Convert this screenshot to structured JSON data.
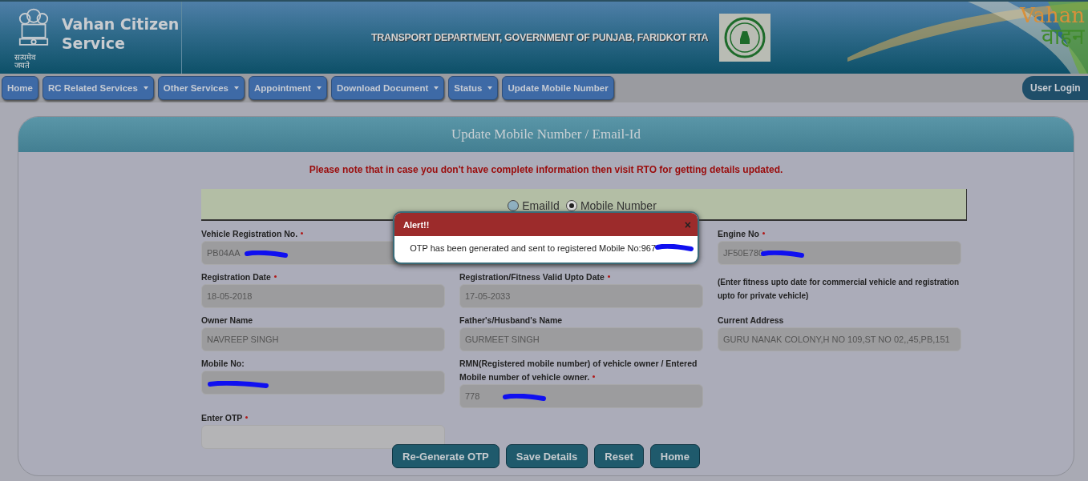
{
  "header": {
    "title": "Vahan Citizen Service",
    "motto": "सत्यमेव जयते",
    "department": "TRANSPORT DEPARTMENT, GOVERNMENT OF PUNJAB, FARIDKOT RTA",
    "logo_text": [
      "Vahan",
      "वाहन"
    ]
  },
  "nav": {
    "items": [
      {
        "label": "Home",
        "dropdown": false
      },
      {
        "label": "RC Related Services",
        "dropdown": true
      },
      {
        "label": "Other Services",
        "dropdown": true
      },
      {
        "label": "Appointment",
        "dropdown": true
      },
      {
        "label": "Download Document",
        "dropdown": true
      },
      {
        "label": "Status",
        "dropdown": true
      },
      {
        "label": "Update Mobile Number",
        "dropdown": false
      }
    ],
    "login": "User Login"
  },
  "panel": {
    "title": "Update Mobile Number / Email-Id",
    "notice": "Please note that in case you don't have complete information then visit RTO for getting details updated.",
    "options": [
      {
        "label": "EmailId",
        "selected": false
      },
      {
        "label": "Mobile Number",
        "selected": true
      }
    ],
    "cells": [
      {
        "kind": "field",
        "label": "Vehicle Registration No.",
        "required": true,
        "value": "PB04AA",
        "redacted": true
      },
      {
        "kind": "hidden"
      },
      {
        "kind": "field",
        "label": "Engine No",
        "required": true,
        "value": "JF50E780",
        "redacted": true
      },
      {
        "kind": "field",
        "label": "Registration Date",
        "required": true,
        "value": "18-05-2018",
        "redacted": false
      },
      {
        "kind": "field",
        "label": "Registration/Fitness Valid Upto Date",
        "required": true,
        "value": "17-05-2033",
        "redacted": false
      },
      {
        "kind": "note",
        "text": "(Enter fitness upto date for commercial vehicle and registration upto for private vehicle)"
      },
      {
        "kind": "field",
        "label": "Owner Name",
        "required": false,
        "value": "NAVREEP SINGH",
        "redacted": false
      },
      {
        "kind": "field",
        "label": "Father's/Husband's Name",
        "required": false,
        "value": "GURMEET SINGH",
        "redacted": false
      },
      {
        "kind": "field",
        "label": "Current Address",
        "required": false,
        "value": "GURU NANAK COLONY,H NO 109,ST NO 02,,45,PB,151",
        "redacted": false
      },
      {
        "kind": "field",
        "label": "Mobile No:",
        "required": false,
        "redacted": true
      },
      {
        "kind": "field",
        "label": "RMN(Registered mobile number) of vehicle owner / Entered Mobile number of vehicle owner.",
        "required": true,
        "value": "778",
        "redacted": true
      },
      {
        "kind": "hidden"
      },
      {
        "kind": "input",
        "label": "Enter OTP",
        "required": true,
        "redacted": false
      }
    ],
    "buttons": [
      "Re-Generate OTP",
      "Save Details",
      "Reset",
      "Home"
    ]
  },
  "alert": {
    "title": "Alert!!",
    "close": "×",
    "message": "OTP has been generated and sent to registered Mobile No:967",
    "redacted": true
  }
}
